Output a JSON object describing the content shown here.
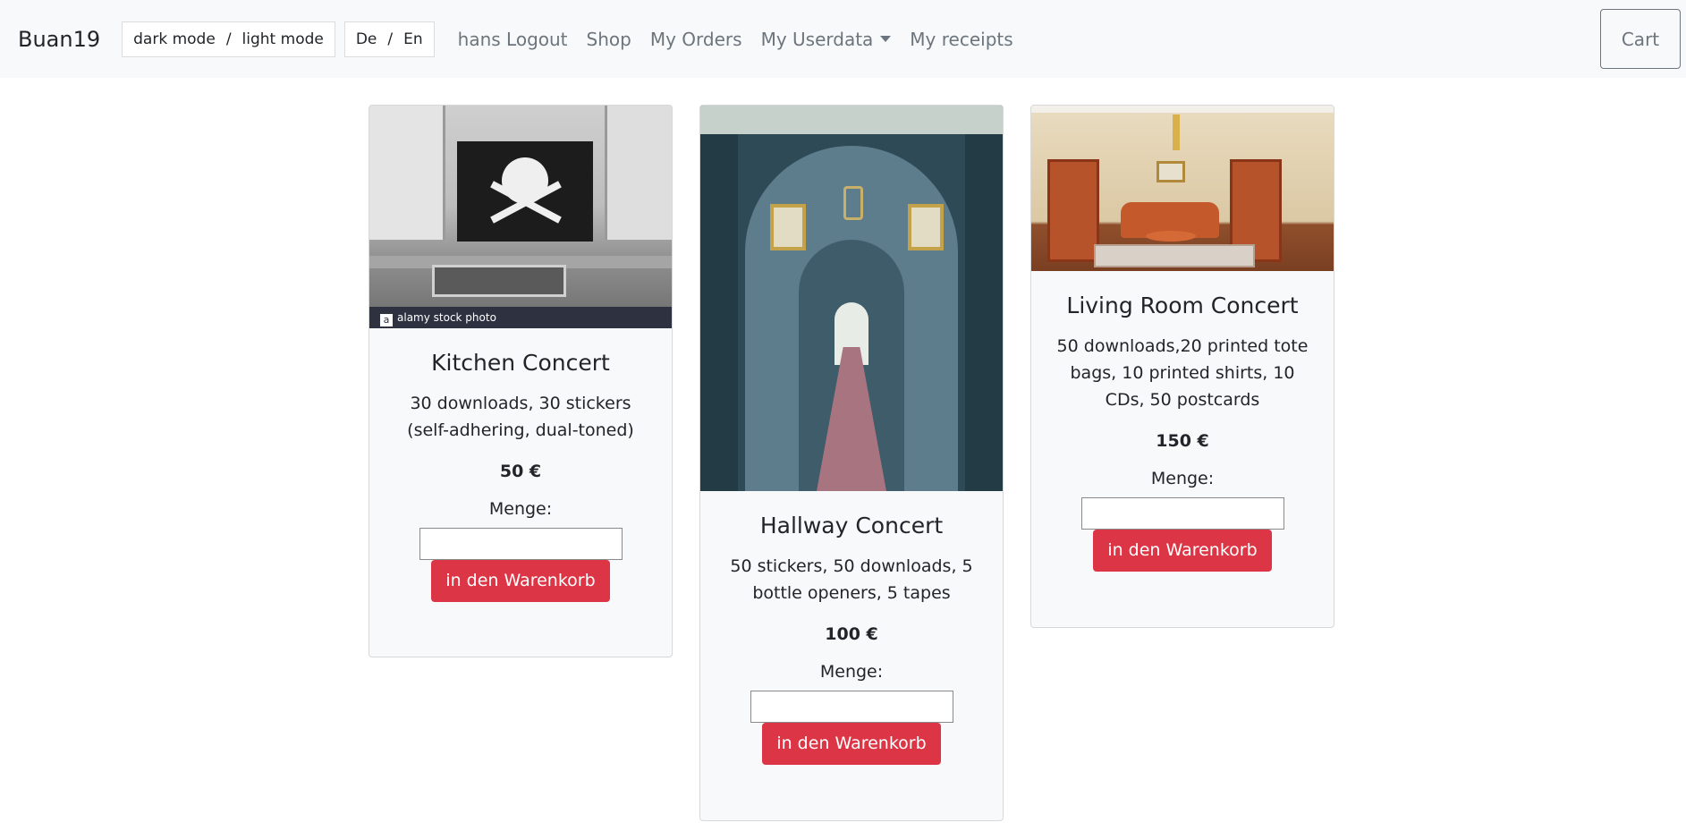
{
  "navbar": {
    "brand": "Buan19",
    "theme": {
      "dark": "dark mode",
      "separator": "/",
      "light": "light mode"
    },
    "lang": {
      "de": "De",
      "separator": "/",
      "en": "En"
    },
    "links": {
      "logout": "hans Logout",
      "shop": "Shop",
      "orders": "My Orders",
      "userdata": "My Userdata",
      "receipts": "My receipts"
    },
    "cart": "Cart"
  },
  "products": [
    {
      "title": "Kitchen Concert",
      "description": "30 downloads, 30 stickers (self-adhering, dual-toned)",
      "price": "50 €",
      "quantity_label": "Menge:",
      "quantity_value": "",
      "button": "in den Warenkorb",
      "image_watermark": "alamy stock photo",
      "image_icon": "a"
    },
    {
      "title": "Hallway Concert",
      "description": "50 stickers, 50 downloads, 5 bottle openers, 5 tapes",
      "price": "100 €",
      "quantity_label": "Menge:",
      "quantity_value": "",
      "button": "in den Warenkorb"
    },
    {
      "title": "Living Room Concert",
      "description": "50 downloads,20 printed tote bags, 10 printed shirts, 10 CDs, 50 postcards",
      "price": "150 €",
      "quantity_label": "Menge:",
      "quantity_value": "",
      "button": "in den Warenkorb"
    }
  ],
  "colors": {
    "navbar_bg": "#f8f9fa",
    "button_danger": "#dc3545",
    "link_muted": "#6c757d"
  }
}
